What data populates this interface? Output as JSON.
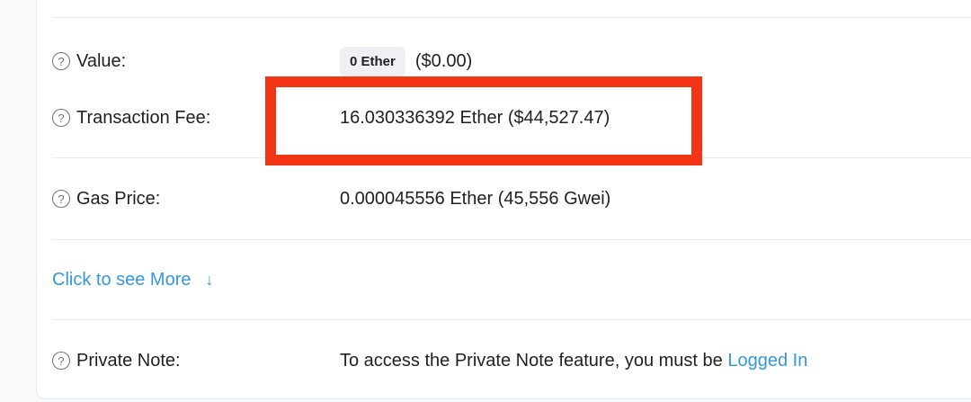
{
  "rows": {
    "value": {
      "label": "Value:",
      "badge": "0 Ether",
      "usd": "($0.00)"
    },
    "fee": {
      "label": "Transaction Fee:",
      "value": "16.030336392 Ether ($44,527.47)"
    },
    "gas": {
      "label": "Gas Price:",
      "value": "0.000045556 Ether (45,556 Gwei)"
    },
    "more": {
      "label": "Click to see More",
      "arrow": "↓"
    },
    "note": {
      "label": "Private Note:",
      "text": "To access the Private Note feature, you must be",
      "link": "Logged In"
    }
  },
  "icons": {
    "help": "?"
  },
  "colors": {
    "highlight": "#f23515",
    "link": "#3498db",
    "badge_bg": "#eef0f3"
  }
}
